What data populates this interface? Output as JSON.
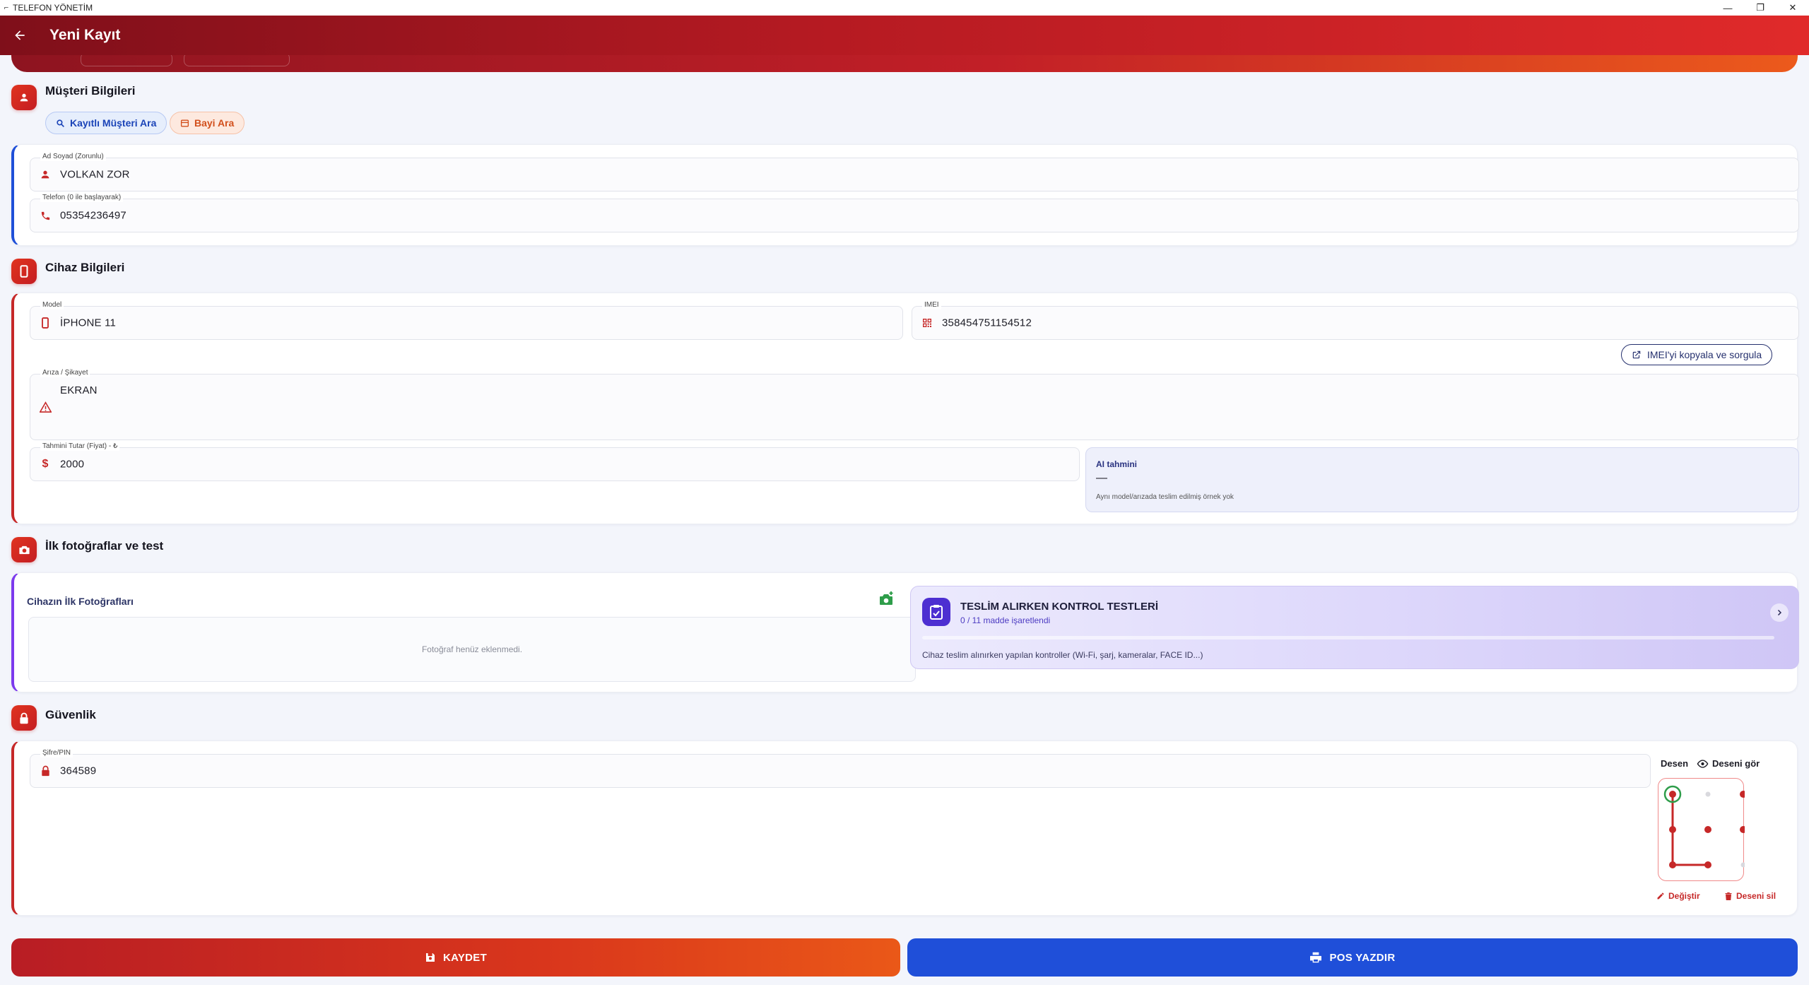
{
  "window": {
    "title": "TELEFON YÖNETİM",
    "controls": [
      "minimize",
      "restore",
      "close"
    ]
  },
  "appbar": {
    "title": "Yeni Kayıt"
  },
  "customer": {
    "section_title": "Müşteri Bilgileri",
    "search_registered": "Kayıtlı Müşteri Ara",
    "search_dealer": "Bayi Ara",
    "name_label": "Ad Soyad (Zorunlu)",
    "name_value": "VOLKAN ZOR",
    "phone_label": "Telefon (0 ile başlayarak)",
    "phone_value": "05354236497"
  },
  "device": {
    "section_title": "Cihaz Bilgileri",
    "model_label": "Model",
    "model_value": "İPHONE 11",
    "imei_label": "IMEI",
    "imei_value": "358454751154512",
    "imei_query_button": "IMEI'yi kopyala ve sorgula",
    "fault_label": "Arıza / Şikayet",
    "fault_value": "EKRAN",
    "price_label": "Tahmini Tutar (Fiyat) - ₺",
    "price_value": "2000",
    "ai_title": "AI tahmini",
    "ai_value": "—",
    "ai_note": "Aynı model/arızada teslim edilmiş örnek yok"
  },
  "photos": {
    "section_title": "İlk fotoğraflar ve test",
    "label": "Cihazın İlk Fotoğrafları",
    "empty_text": "Fotoğraf henüz eklenmedi.",
    "tests_title": "TESLİM ALIRKEN KONTROL TESTLERİ",
    "tests_progress": "0 / 11 madde işaretlendi",
    "tests_progress_fraction": 0,
    "tests_desc": "Cihaz teslim alınırken yapılan kontroller (Wi-Fi, şarj, kameralar, FACE ID...)"
  },
  "security": {
    "section_title": "Güvenlik",
    "pin_label": "Şifre/PIN",
    "pin_value": "364589",
    "pattern_label": "Desen",
    "show_pattern": "Deseni gör",
    "change": "Değiştir",
    "delete": "Deseni sil",
    "pattern_sequence": [
      1,
      4,
      7,
      8
    ]
  },
  "footer": {
    "save": "KAYDET",
    "print": "POS YAZDIR"
  },
  "colors": {
    "primary_red": "#c62828",
    "accent_orange": "#e8571a",
    "print_blue": "#1f4fd9",
    "test_purple": "#4d2fd1"
  }
}
